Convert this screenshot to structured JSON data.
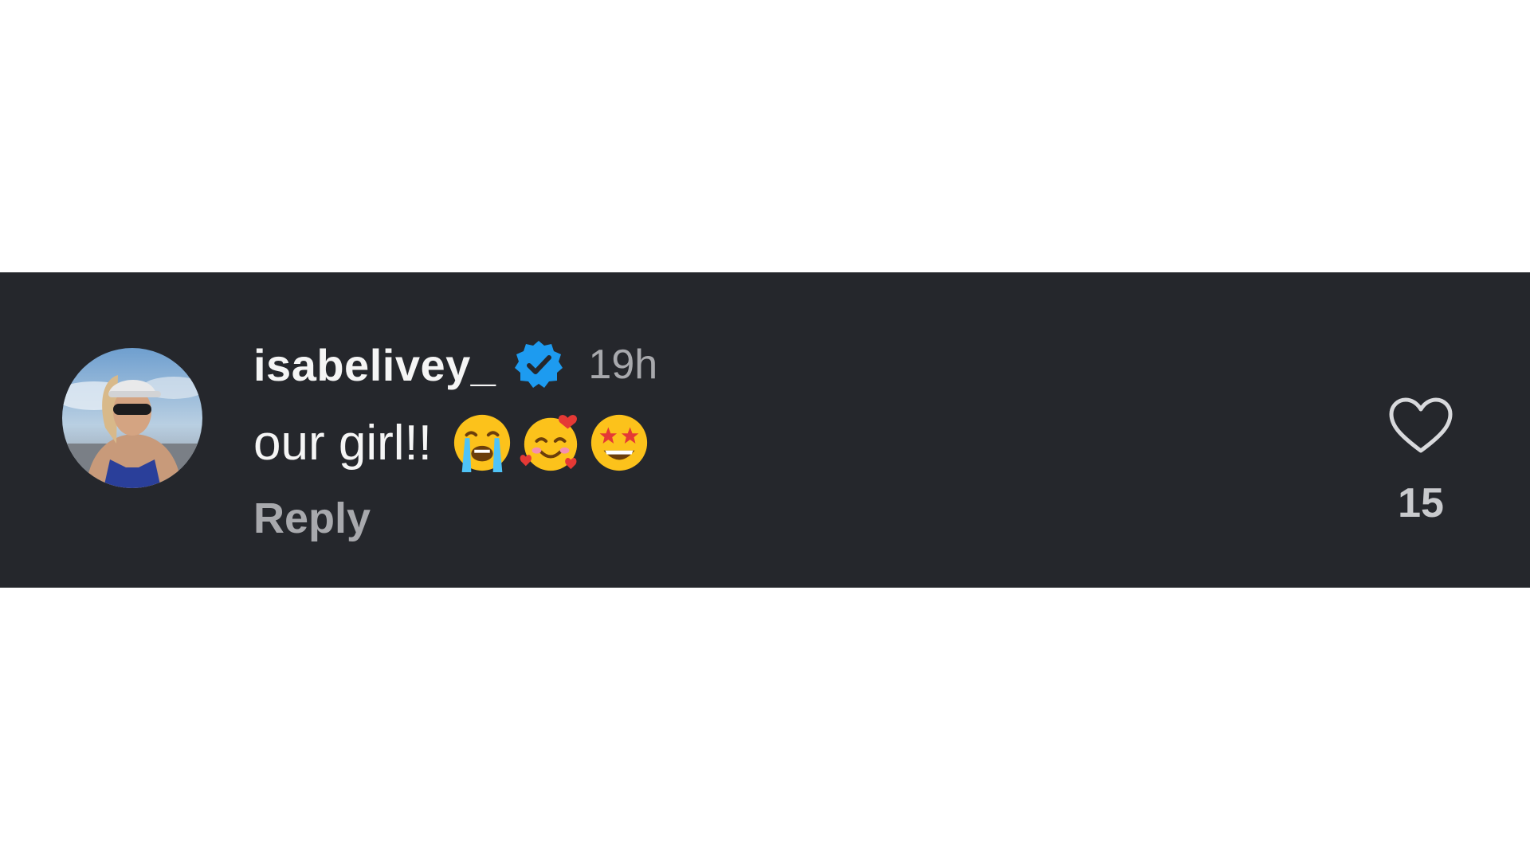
{
  "comment": {
    "username": "isabelivey_",
    "verified": true,
    "timestamp": "19h",
    "text": "our girl!!",
    "emojis": [
      "loudly-crying-face",
      "smiling-face-with-hearts",
      "star-struck"
    ],
    "reply_label": "Reply",
    "like_count": "15"
  },
  "colors": {
    "band_background": "#25272c",
    "verified_blue": "#1d9bf0",
    "primary_text": "#f5f5f5",
    "secondary_text": "#a8a9ad"
  },
  "icons": {
    "avatar": "profile-photo",
    "badge": "verified-badge-icon",
    "like": "heart-outline-icon"
  }
}
